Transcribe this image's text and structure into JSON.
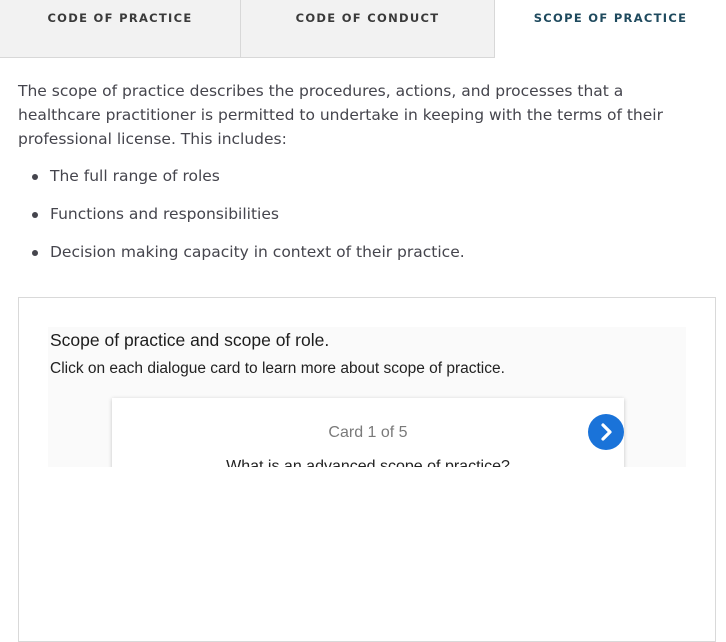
{
  "tabs": [
    {
      "label": "CODE OF PRACTICE",
      "active": false
    },
    {
      "label": "CODE OF CONDUCT",
      "active": false
    },
    {
      "label": "SCOPE OF PRACTICE",
      "active": true
    }
  ],
  "content": {
    "intro": "The scope of practice describes the procedures, actions, and processes that a healthcare practitioner is permitted to undertake in keeping with the terms of their professional license. This includes:",
    "bullets": [
      "The full range of roles",
      "Functions and responsibilities",
      "Decision making capacity in context of their practice."
    ]
  },
  "embed": {
    "title": "Scope of practice and scope of role.",
    "subtitle": "Click on each dialogue card to learn more about scope of practice.",
    "card": {
      "counter": "Card 1 of 5",
      "question": "What is an advanced scope of practice?",
      "next_icon": "chevron-right-icon"
    }
  },
  "colors": {
    "active_tab_text": "#1f4a5e",
    "inactive_tab_bg": "#f2f2f2",
    "next_button": "#1a73d9"
  }
}
